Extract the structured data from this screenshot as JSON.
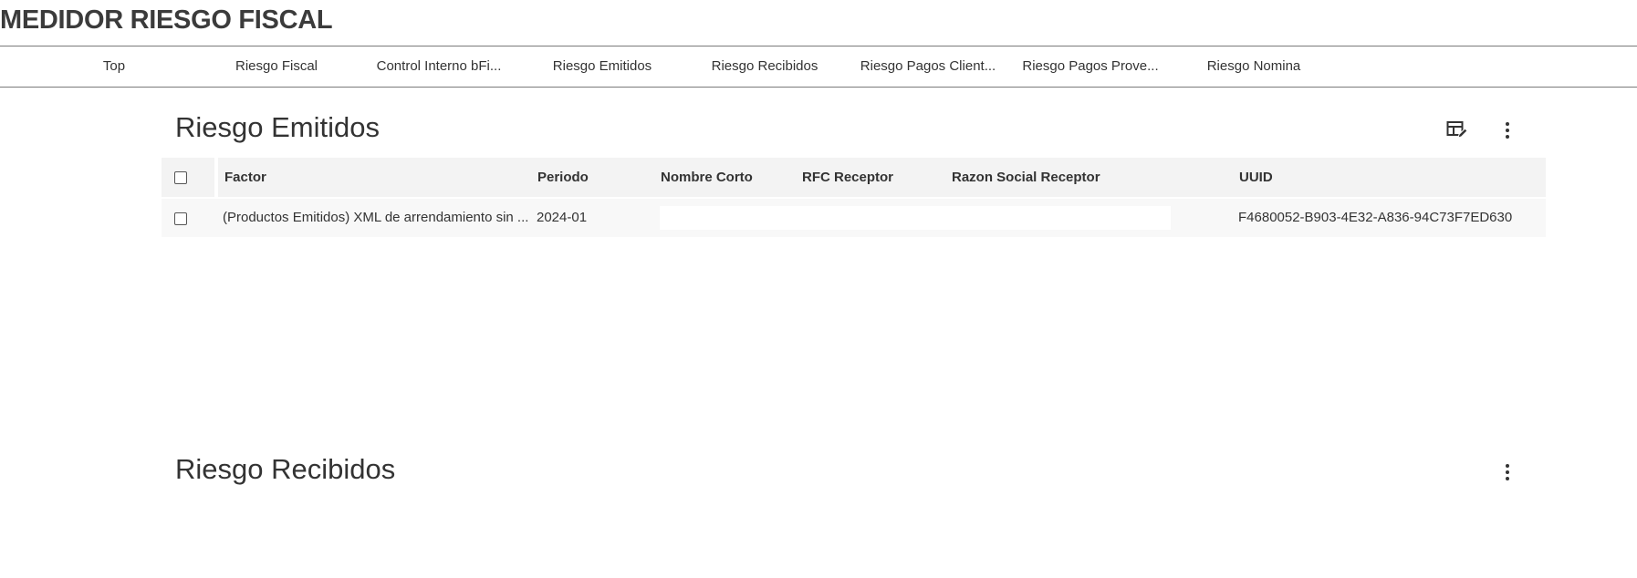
{
  "app": {
    "title": "MEDIDOR RIESGO FISCAL"
  },
  "nav": {
    "tabs": [
      {
        "label": "Top"
      },
      {
        "label": "Riesgo Fiscal"
      },
      {
        "label": "Control Interno bFi..."
      },
      {
        "label": "Riesgo Emitidos"
      },
      {
        "label": "Riesgo Recibidos"
      },
      {
        "label": "Riesgo Pagos Client..."
      },
      {
        "label": "Riesgo Pagos Prove..."
      },
      {
        "label": "Riesgo Nomina"
      }
    ]
  },
  "emitidos": {
    "title": "Riesgo Emitidos",
    "icons": {
      "edit_table": "table-edit-icon",
      "more": "more-vert-icon"
    },
    "columns": [
      "Factor",
      "Periodo",
      "Nombre Corto",
      "RFC Receptor",
      "Razon Social Receptor",
      "UUID"
    ],
    "rows": [
      {
        "factor": "(Productos Emitidos) XML de arrendamiento sin ...",
        "periodo": "2024-01",
        "nombre_corto": "",
        "rfc_receptor": "",
        "razon_social_receptor": "",
        "uuid": "F4680052-B903-4E32-A836-94C73F7ED630"
      }
    ]
  },
  "recibidos": {
    "title": "Riesgo Recibidos",
    "icons": {
      "more": "more-vert-icon"
    }
  }
}
